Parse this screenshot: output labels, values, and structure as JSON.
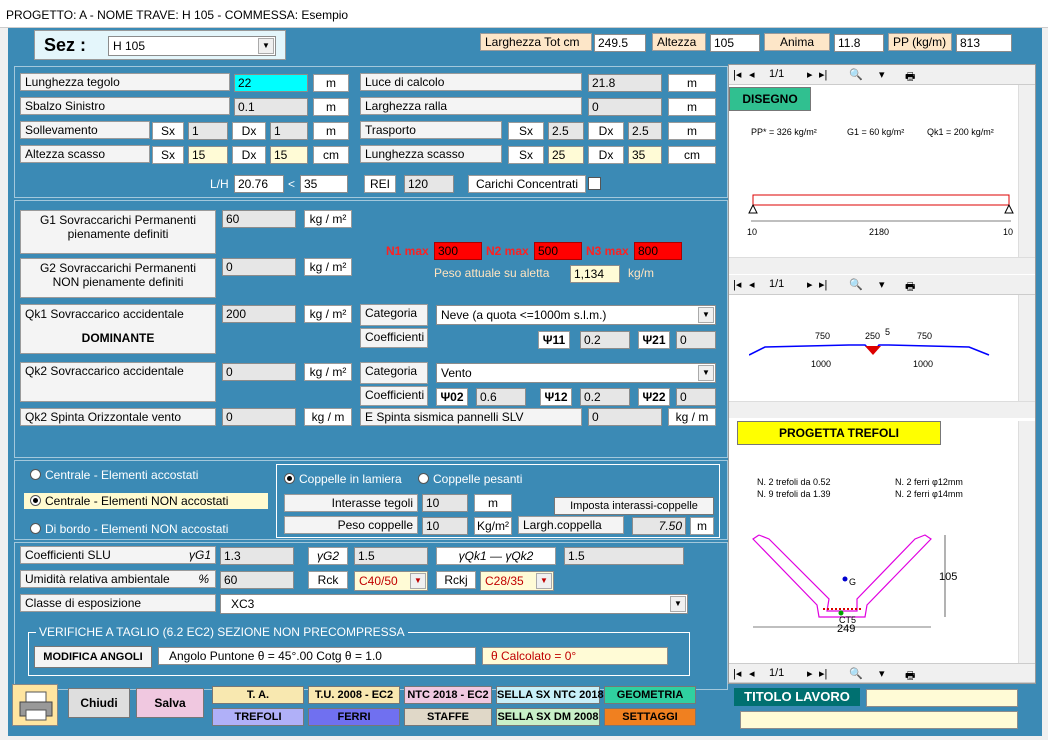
{
  "title": "PROGETTO: A - NOME TRAVE: H 105 - COMMESSA: Esempio",
  "header": {
    "sez_label": "Sez :",
    "sez_value": "H 105",
    "larghezza_label": "Larghezza Tot  cm",
    "larghezza_value": "249.5",
    "altezza_label": "Altezza",
    "altezza_value": "105",
    "anima_label": "Anima",
    "anima_value": "11.8",
    "pp_label": "PP (kg/m)",
    "pp_value": "813"
  },
  "geometry": {
    "lunghezza_label": "Lunghezza tegolo",
    "lunghezza_value": "22",
    "sbalzo_label": "Sbalzo Sinistro",
    "sbalzo_value": "0.1",
    "sollevamento_label": "Sollevamento",
    "sollevamento_sx": "1",
    "sollevamento_dx": "1",
    "altezza_scasso_label": "Altezza  scasso",
    "altezza_scasso_sx": "15",
    "altezza_scasso_dx": "15",
    "luce_label": "Luce di calcolo",
    "luce_value": "21.8",
    "ralla_label": "Larghezza ralla",
    "ralla_value": "0",
    "trasporto_label": "Trasporto",
    "trasporto_sx": "2.5",
    "trasporto_dx": "2.5",
    "lung_scasso_label": "Lunghezza scasso",
    "lung_scasso_sx": "25",
    "lung_scasso_dx": "35",
    "sx": "Sx",
    "dx": "Dx",
    "unit_m": "m",
    "unit_cm": "cm",
    "lh_label": "L/H",
    "lh_value": "20.76",
    "lh_lt": "<",
    "lh_limit": "35",
    "rei_label": "REI",
    "rei_value": "120",
    "carichi_label": "Carichi Concentrati"
  },
  "loads": {
    "g1_label": "G1   Sovraccarichi Permanenti\npienamente definiti",
    "g1_line1": "G1   Sovraccarichi Permanenti",
    "g1_line2": "pienamente definiti",
    "g1_value": "60",
    "g2_line1": "G2   Sovraccarichi Permanenti",
    "g2_line2": "NON pienamente definiti",
    "g2_value": "0",
    "unit_kgm2": "kg / m²",
    "unit_kgm": "kg / m",
    "n1_label": "N1 max",
    "n1_value": "300",
    "n2_label": "N2 max",
    "n2_value": "500",
    "n3_label": "N3 max",
    "n3_value": "800",
    "peso_label": "Peso attuale su aletta",
    "peso_value": "1,134",
    "peso_unit": "kg/m",
    "qk1_line1": "Qk1 Sovraccarico accidentale",
    "qk1_line2": "DOMINANTE",
    "qk1_value": "200",
    "categoria_label": "Categoria",
    "coefficienti_label": "Coefficienti",
    "qk1_categoria": "Neve (a quota <=1000m s.l.m.)",
    "psi11_label": "Ψ11",
    "psi11_value": "0.2",
    "psi21_label": "Ψ21",
    "psi21_value": "0",
    "qk2_label": "Qk2  Sovraccarico accidentale",
    "qk2_value": "0",
    "qk2_categoria": "Vento",
    "psi02_label": "Ψ02",
    "psi02_value": "0.6",
    "psi12_label": "Ψ12",
    "psi12_value": "0.2",
    "psi22_label": "Ψ22",
    "psi22_value": "0",
    "qk2v_label": "Qk2       Spinta Orizzontale vento",
    "qk2v_value": "0",
    "sisma_label": "E Spinta sismica pannelli  SLV",
    "sisma_value": "0"
  },
  "position": {
    "opt1": "Centrale - Elementi accostati",
    "opt2": "Centrale  - Elementi NON accostati",
    "opt3": "Di bordo - Elementi NON accostati",
    "copp1": "Coppelle in lamiera",
    "copp2": "Coppelle pesanti",
    "interasse_label": "Interasse tegoli",
    "interasse_value": "10",
    "interasse_unit": "m",
    "peso_copp_label": "Peso coppelle",
    "peso_copp_value": "10",
    "peso_copp_unit": "Kg/m²",
    "imposta_btn": "Imposta interassi-coppelle",
    "largh_label": "Largh.coppella",
    "largh_value": "7.50",
    "largh_unit": "m"
  },
  "materials": {
    "slu_label": "Coefficienti SLU",
    "g1_label": "γG1",
    "g1_value": "1.3",
    "g2_label": "γG2",
    "g2_value": "1.5",
    "qk_label": "γQk1  — γQk2",
    "qk_value": "1.5",
    "umidita_label": "Umidità relativa ambientale",
    "umidita_unit": "%",
    "umidita_value": "60",
    "rck_label": "Rck",
    "rck_value": "C40/50",
    "rckj_label": "Rckj",
    "rckj_value": "C28/35",
    "classe_label": "Classe di esposizione",
    "classe_value": "XC3"
  },
  "verifiche": {
    "title": "VERIFICHE A TAGLIO (6.2 EC2) SEZIONE NON PRECOMPRESSA",
    "modifica_btn": "MODIFICA ANGOLI",
    "puntone": "Angolo Puntone  θ  =  45°.00       Cotg θ = 1.0",
    "calcolato": "θ  Calcolato =  0°"
  },
  "footer": {
    "chiudi": "Chiudi",
    "salva": "Salva",
    "ta": "T. A.",
    "tu2008": "T.U. 2008 - EC2",
    "ntc2018": "NTC 2018 - EC2",
    "sella_ntc": "SELLA SX NTC 2018",
    "geometria": "GEOMETRIA",
    "trefoli": "TREFOLI",
    "ferri": "FERRI",
    "staffe": "STAFFE",
    "sella_dm": "SELLA SX DM 2008",
    "settaggi": "SETTAGGI",
    "titolo_lavoro": "TITOLO LAVORO"
  },
  "preview": {
    "page": "1/1",
    "disegno_btn": "DISEGNO",
    "pp_text": "PP* = 326 kg/m²",
    "g1_text": "G1 = 60 kg/m²",
    "qk1_text": "Qk1 = 200 kg/m²",
    "beam_left": "10",
    "beam_mid": "2180",
    "beam_right": "10",
    "sec_750a": "750",
    "sec_250": "250",
    "sec_5": "5",
    "sec_750b": "750",
    "sec_1000a": "1000",
    "sec_1000b": "1000",
    "progetta_btn": "PROGETTA TREFOLI",
    "tref1": "N. 2 trefoli da 0.52",
    "tref2": "N. 9 trefoli da 1.39",
    "ferri1": "N. 2 ferri  φ12mm",
    "ferri2": "N. 2 ferri  φ14mm",
    "dim_h": "105",
    "dim_w": "249",
    "g_label": "G",
    "ct_label": "CT5"
  }
}
